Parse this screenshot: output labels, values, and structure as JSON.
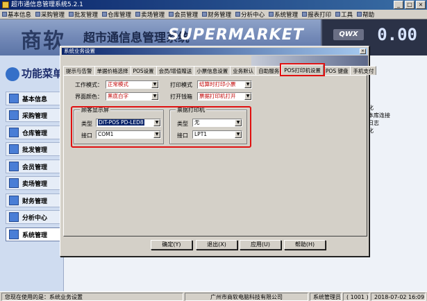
{
  "window": {
    "title": "超市通信息管理系统5.2.1"
  },
  "menu": [
    "基本信息",
    "采购管理",
    "批发管理",
    "仓库管理",
    "卖场管理",
    "会员管理",
    "财务管理",
    "分析中心",
    "系统管理",
    "报表打印",
    "工具",
    "帮助"
  ],
  "banner": {
    "logo_cn": "商软",
    "logo_sub": "超市通信息管理系统",
    "logo_en": "SUPERMARKET",
    "display_tag": "QWX",
    "display_amount": "0.00"
  },
  "sidebar": {
    "title": "功能菜单",
    "items": [
      "基本信息",
      "采购管理",
      "仓库管理",
      "批发管理",
      "会员管理",
      "卖场管理",
      "财务管理",
      "分析中心",
      "系统管理"
    ]
  },
  "background_list": [
    "化",
    "",
    "",
    "",
    "本库连接",
    "日志",
    "",
    "",
    "",
    "化"
  ],
  "dialog": {
    "title": "系统业务设置",
    "close": "×",
    "tabs": [
      "提示与告警",
      "单据价格选择",
      "POS设置",
      "会员/增值赠送",
      "小票信息设置",
      "业务默认",
      "自助服务",
      "POS打印机设置",
      "POS 键盘",
      "手机支付"
    ],
    "fields": {
      "work_mode_label": "工作模式：",
      "work_mode_value": "正常模式",
      "ui_color_label": "界面颜色：",
      "ui_color_value": "黑底白字",
      "print_mode_label": "打印模式",
      "print_mode_value": "结算时打印小票",
      "cash_drawer_label": "打开钱箱",
      "cash_drawer_value": "票据打印机打开"
    },
    "customer_display": {
      "legend": "顾客显示屏",
      "type_label": "类型",
      "type_value": "DIT-POS PD-LED8",
      "port_label": "接口",
      "port_value": "COM1"
    },
    "receipt_printer": {
      "legend": "票据打印机",
      "type_label": "类型",
      "type_value": "无",
      "port_label": "接口",
      "port_value": "LPT1"
    },
    "buttons": {
      "ok": "确定(Y)",
      "exit": "退出(X)",
      "apply": "应用(U)",
      "help": "帮助(H)"
    }
  },
  "status": {
    "current": "您现在使用的是：系统业务设置",
    "company": "广州市商软电脑科技有限公司",
    "user": "系统管理员",
    "code": "( 1001 )",
    "datetime": "2018-07-02 16:09:51"
  },
  "colors": {
    "highlight_box": "#e01010",
    "title_bar": "#0a246a"
  }
}
